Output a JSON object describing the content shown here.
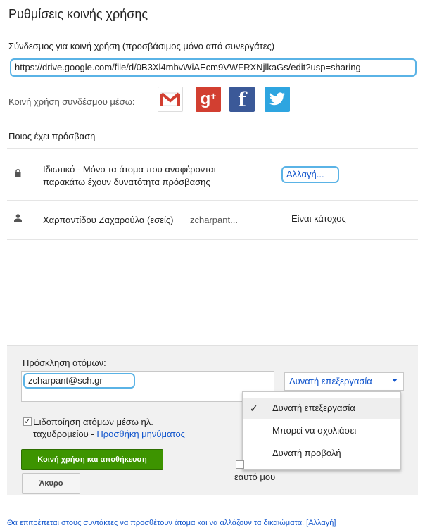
{
  "dialog": {
    "title": "Ρυθμίσεις κοινής χρήσης"
  },
  "link": {
    "label": "Σύνδεσμος για κοινή χρήση (προσβάσιμος μόνο από συνεργάτες)",
    "url": "https://drive.google.com/file/d/0B3Xl4mbvWiAEcm9VWFRXNjlkaGs/edit?usp=sharing"
  },
  "share_via": {
    "label": "Κοινή χρήση συνδέσμου μέσω:",
    "services": [
      "gmail-icon",
      "google-plus-icon",
      "facebook-icon",
      "twitter-icon"
    ]
  },
  "access": {
    "label": "Ποιος έχει πρόσβαση",
    "privacy_text": "Ιδιωτικό - Μόνο τα άτομα που αναφέρονται παρακάτω έχουν δυνατότητα πρόσβασης",
    "change_label": "Αλλαγή...",
    "owner_name": "Χαρπαντίδου Ζαχαρούλα (εσείς)",
    "owner_email": "zcharpant...",
    "owner_role": "Είναι κάτοχος"
  },
  "invite": {
    "label": "Πρόσκληση ατόμων:",
    "chip": "zcharpant@sch.gr",
    "permission_selected": "Δυνατή επεξεργασία",
    "menu_items": [
      "Δυνατή επεξεργασία",
      "Μπορεί να σχολιάσει",
      "Δυνατή προβολή"
    ],
    "notify_text_line1": "Ειδοποίηση ατόμων μέσω ηλ.",
    "notify_text_line2": "ταχυδρομείου - ",
    "add_message": "Προσθήκη μηνύματος",
    "share_save_label": "Κοινή χρήση και αποθήκευση",
    "cancel_label": "Άκυρο",
    "self_text": "εαυτό μου"
  },
  "footer": {
    "text": "Θα επιτρέπεται στους συντάκτες να προσθέτουν άτομα και να αλλάζουν τα δικαιώματα. [Αλλαγή]"
  },
  "colors": {
    "highlight_border": "#5ab3e6",
    "link": "#1155cc",
    "primary_button": "#3d9400"
  }
}
